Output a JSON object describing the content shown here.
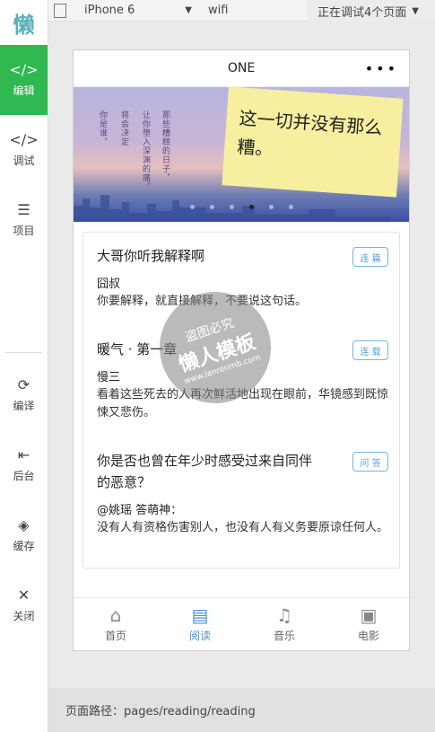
{
  "sidebar": {
    "logo": "懒",
    "items": [
      {
        "label": "编辑",
        "icon": "code-window-icon",
        "glyph": "</>"
      },
      {
        "label": "调试",
        "icon": "code-icon",
        "glyph": "</>"
      },
      {
        "label": "项目",
        "icon": "menu-icon",
        "glyph": "☰"
      },
      {
        "label": "编译",
        "icon": "compile-icon",
        "glyph": "⟳"
      },
      {
        "label": "后台",
        "icon": "background-icon",
        "glyph": "⇤"
      },
      {
        "label": "缓存",
        "icon": "layers-icon",
        "glyph": "◈"
      },
      {
        "label": "关闭",
        "icon": "close-icon",
        "glyph": "✕"
      }
    ]
  },
  "toolbar": {
    "device": "iPhone 6",
    "network": "wifi",
    "status": "正在调试4个页面"
  },
  "nav": {
    "title": "ONE",
    "more": "•••"
  },
  "banner": {
    "poem_lines": [
      "你是谁。",
      "将会决定",
      "让你堕入深渊的痛，",
      "那些糟糕的日子，"
    ],
    "note_text": "这一切并没有那么糟。"
  },
  "entries": [
    {
      "title": "大哥你听我解释啊",
      "tag": "连 篇",
      "author": "囧叔",
      "body": "你要解释，就直接解释，不要说这句话。"
    },
    {
      "title": "暖气 · 第一章",
      "tag": "连 载",
      "author": "慢三",
      "body": "看着这些死去的人再次鲜活地出现在眼前，华镜感到既惊悚又悲伤。"
    },
    {
      "title": "你是否也曾在年少时感受过来自同伴的恶意？",
      "tag": "问 答",
      "author": "@姚瑶 答萌神：",
      "body": "没有人有资格伤害别人，也没有人有义务要原谅任何人。"
    }
  ],
  "tabs": [
    {
      "label": "首页",
      "icon": "home-icon",
      "glyph": "⌂"
    },
    {
      "label": "阅读",
      "icon": "reading-icon",
      "glyph": "▤"
    },
    {
      "label": "音乐",
      "icon": "music-icon",
      "glyph": "♫"
    },
    {
      "label": "电影",
      "icon": "movie-icon",
      "glyph": "▣"
    }
  ],
  "footer": {
    "path": "页面路径：pages/reading/reading"
  },
  "watermark": {
    "line1": "盗图必究",
    "line2": "懒人模板",
    "line3": "www.lanrenmb.com"
  }
}
